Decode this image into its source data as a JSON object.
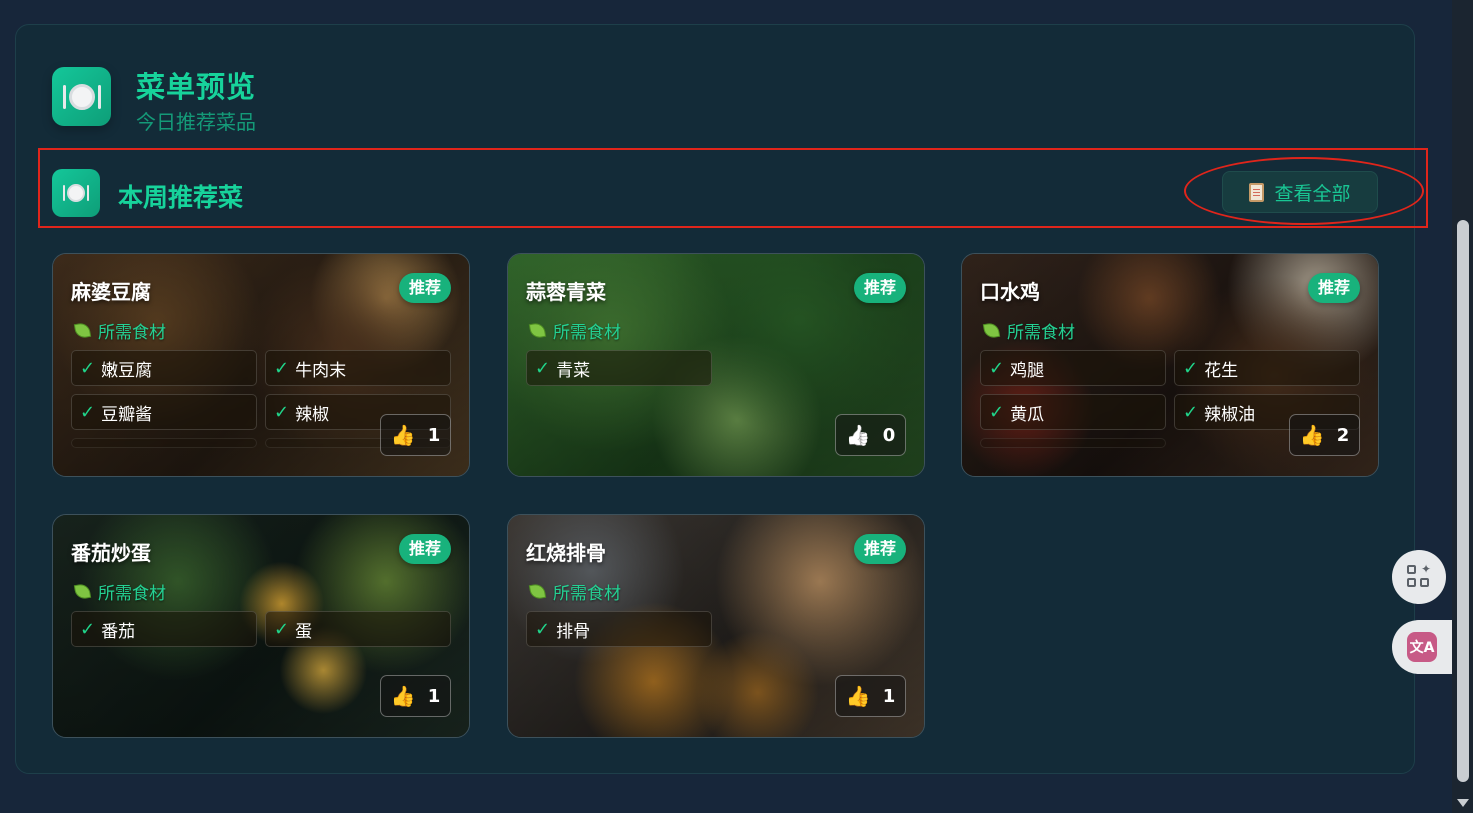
{
  "header": {
    "title": "菜单预览",
    "subtitle": "今日推荐菜品"
  },
  "section": {
    "title": "本周推荐菜",
    "view_all_label": "查看全部"
  },
  "cards": [
    {
      "name": "麻婆豆腐",
      "badge": "推荐",
      "ingredients_label": "所需食材",
      "ingredients": [
        "嫩豆腐",
        "牛肉末",
        "豆瓣酱",
        "辣椒"
      ],
      "likes": "1",
      "liked": true
    },
    {
      "name": "蒜蓉青菜",
      "badge": "推荐",
      "ingredients_label": "所需食材",
      "ingredients": [
        "青菜"
      ],
      "likes": "0",
      "liked": false
    },
    {
      "name": "口水鸡",
      "badge": "推荐",
      "ingredients_label": "所需食材",
      "ingredients": [
        "鸡腿",
        "花生",
        "黄瓜",
        "辣椒油"
      ],
      "likes": "2",
      "liked": true
    },
    {
      "name": "番茄炒蛋",
      "badge": "推荐",
      "ingredients_label": "所需食材",
      "ingredients": [
        "番茄",
        "蛋"
      ],
      "likes": "1",
      "liked": true
    },
    {
      "name": "红烧排骨",
      "badge": "推荐",
      "ingredients_label": "所需食材",
      "ingredients": [
        "排骨"
      ],
      "likes": "1",
      "liked": true
    }
  ],
  "side_buttons": {
    "apps_icon": "apps-sparkle-icon",
    "translate_label": "文A"
  },
  "colors": {
    "accent": "#17d39b",
    "badge": "#18b27c",
    "annotation": "#e0251b"
  }
}
